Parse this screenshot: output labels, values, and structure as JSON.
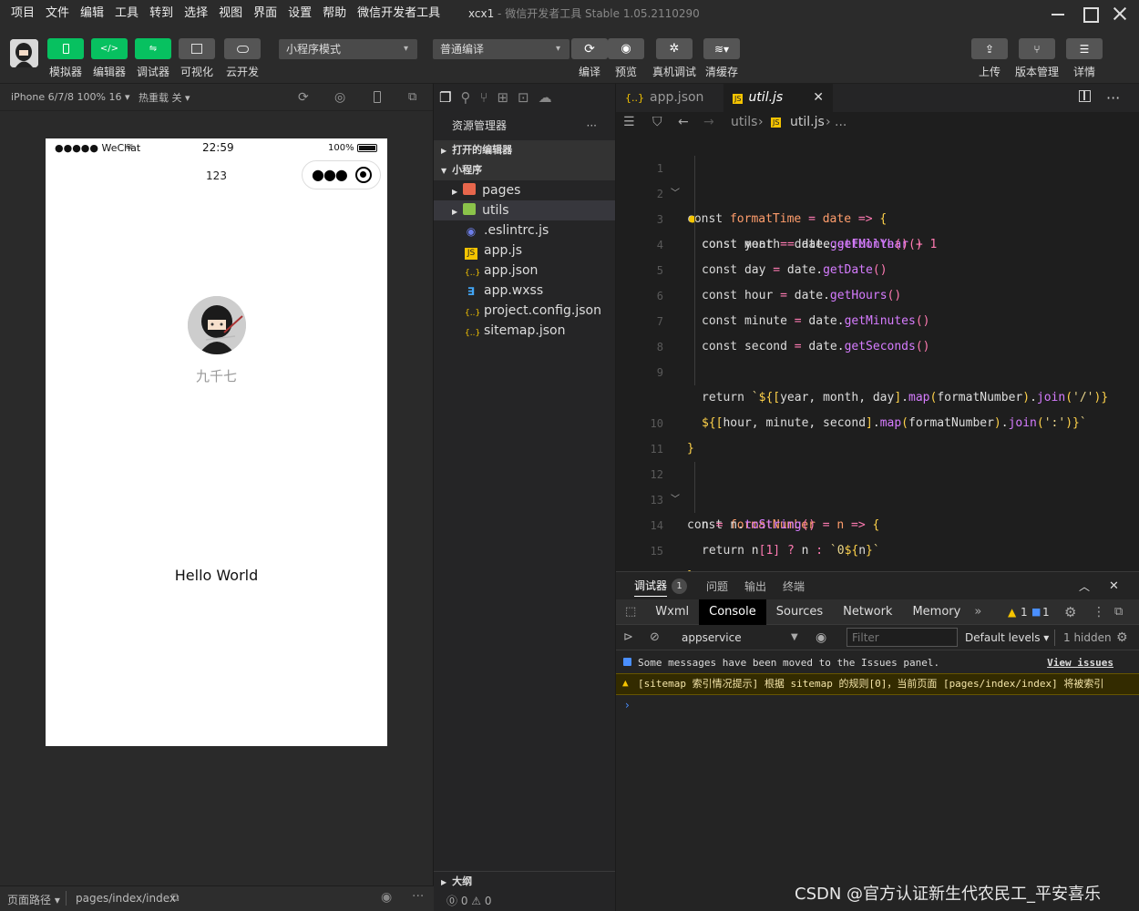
{
  "menu": [
    "项目",
    "文件",
    "编辑",
    "工具",
    "转到",
    "选择",
    "视图",
    "界面",
    "设置",
    "帮助",
    "微信开发者工具"
  ],
  "window_title": {
    "project": "xcx1",
    "app": " - 微信开发者工具 Stable 1.05.2110290"
  },
  "toolbar": {
    "simulator": "模拟器",
    "editor": "编辑器",
    "debugger": "调试器",
    "visual": "可视化",
    "cloud": "云开发",
    "mode": "小程序模式",
    "compile_mode": "普通编译",
    "compile": "编译",
    "preview": "预览",
    "remote_debug": "真机调试",
    "clear_cache": "清缓存",
    "upload": "上传",
    "version": "版本管理",
    "details": "详情"
  },
  "simulator": {
    "device": "iPhone 6/7/8 100% 16",
    "hot_reload": "热重载 关",
    "carrier": "●●●●● WeChat",
    "time": "22:59",
    "battery": "100%",
    "nav_title": "123",
    "nickname": "九千七",
    "hello": "Hello World",
    "footer_path_label": "页面路径",
    "footer_path": "pages/index/index"
  },
  "explorer": {
    "title": "资源管理器",
    "open_editors": "打开的编辑器",
    "project": "小程序",
    "items": [
      {
        "name": "pages",
        "type": "folder-red"
      },
      {
        "name": "utils",
        "type": "folder-green"
      },
      {
        "name": ".eslintrc.js",
        "type": "eslint"
      },
      {
        "name": "app.js",
        "type": "js"
      },
      {
        "name": "app.json",
        "type": "json"
      },
      {
        "name": "app.wxss",
        "type": "css"
      },
      {
        "name": "project.config.json",
        "type": "json"
      },
      {
        "name": "sitemap.json",
        "type": "json"
      }
    ],
    "outline": "大纲",
    "status": "⓪ 0 ⚠ 0"
  },
  "editor": {
    "tabs": [
      {
        "name": "app.json",
        "icon": "{..}"
      },
      {
        "name": "util.js",
        "icon": "JS"
      }
    ],
    "breadcrumb": [
      "utils",
      "util.js",
      "..."
    ],
    "lines": [
      "1",
      "2",
      "3",
      "4",
      "5",
      "6",
      "7",
      "8",
      "9",
      "",
      "10",
      "11",
      "12",
      "13",
      "14",
      "15",
      "16"
    ]
  },
  "panel": {
    "tabs": [
      "调试器",
      "问题",
      "输出",
      "终端"
    ],
    "badge": "1",
    "devtools_tabs": [
      "Wxml",
      "Console",
      "Sources",
      "Network",
      "Memory"
    ],
    "warn_count": "1",
    "info_count": "1",
    "context": "appservice",
    "filter_placeholder": "Filter",
    "levels": "Default levels",
    "hidden": "1 hidden",
    "msg_info": "Some messages have been moved to the Issues panel.",
    "msg_info_link": "View issues",
    "msg_warn": "[sitemap 索引情况提示] 根据 sitemap 的规则[0]，当前页面 [pages/index/index] 将被索引"
  },
  "watermark": "CSDN @官方认证新生代农民工_平安喜乐"
}
